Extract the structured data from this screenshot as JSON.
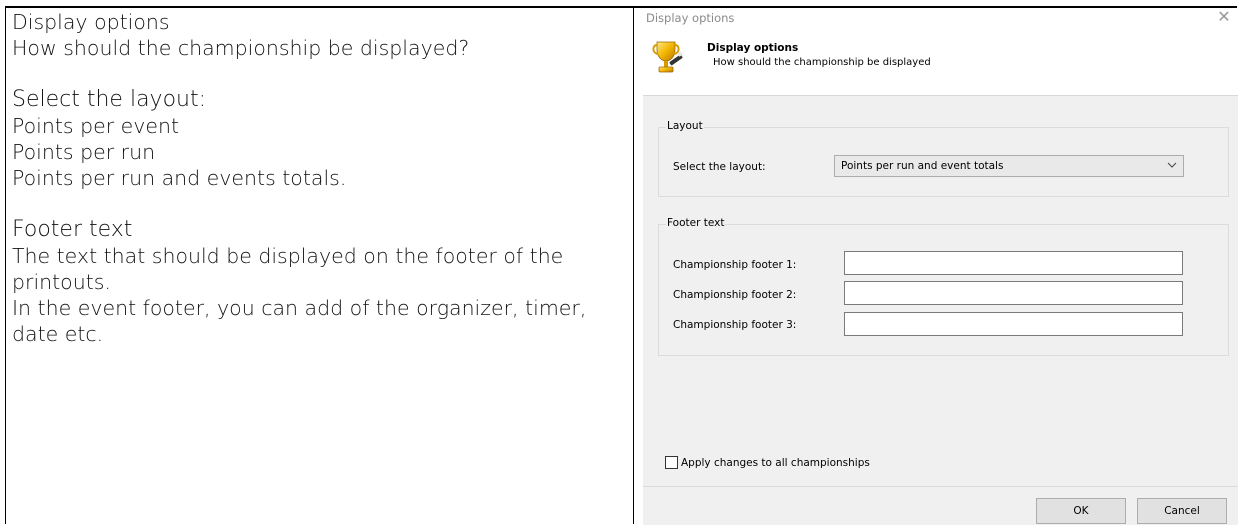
{
  "doc": {
    "left_lines": {
      "l1": "Display options",
      "l2": "How should the championship be displayed?",
      "l3": "Select the layout:",
      "l4": "Points per event",
      "l5": "Points per run",
      "l6": "Points per run and events totals.",
      "l7": "Footer text",
      "l8": "The text that should be displayed on the footer of the printouts.",
      "l9": "In the event footer, you can add of the organizer, timer, date etc."
    }
  },
  "dialog": {
    "window_title": "Display options",
    "header": {
      "title": "Display options",
      "subtitle": "How should the championship be displayed"
    },
    "layout_group": {
      "label": "Layout",
      "select_label": "Select the layout:",
      "select_value": "Points per run and event totals"
    },
    "footer_group": {
      "label": "Footer text",
      "fields": [
        {
          "label": "Championship footer 1:",
          "value": ""
        },
        {
          "label": "Championship footer 2:",
          "value": ""
        },
        {
          "label": "Championship footer 3:",
          "value": ""
        }
      ]
    },
    "apply_all_label": "Apply changes to all championships",
    "apply_all_checked": false,
    "ok_label": "OK",
    "cancel_label": "Cancel"
  },
  "icons": {
    "app": "trophy-icon",
    "close": "close-icon",
    "dropdown": "chevron-down-icon"
  }
}
